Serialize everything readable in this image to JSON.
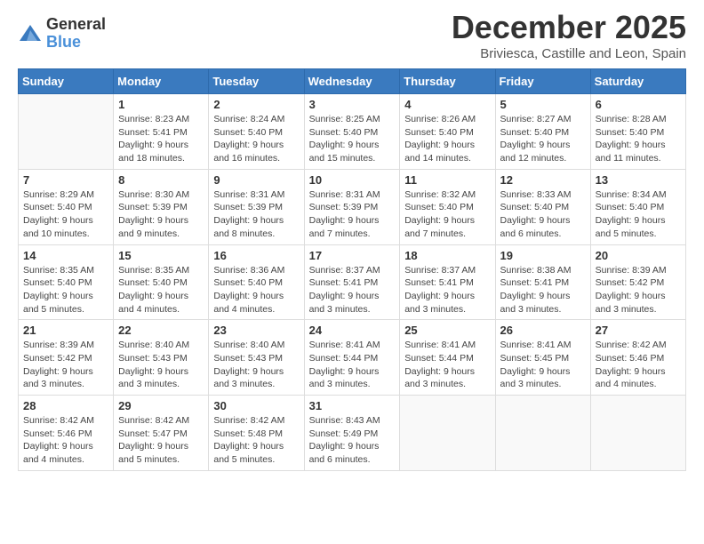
{
  "logo": {
    "general": "General",
    "blue": "Blue"
  },
  "title": "December 2025",
  "subtitle": "Briviesca, Castille and Leon, Spain",
  "days_of_week": [
    "Sunday",
    "Monday",
    "Tuesday",
    "Wednesday",
    "Thursday",
    "Friday",
    "Saturday"
  ],
  "weeks": [
    [
      {
        "day": "",
        "info": ""
      },
      {
        "day": "1",
        "info": "Sunrise: 8:23 AM\nSunset: 5:41 PM\nDaylight: 9 hours\nand 18 minutes."
      },
      {
        "day": "2",
        "info": "Sunrise: 8:24 AM\nSunset: 5:40 PM\nDaylight: 9 hours\nand 16 minutes."
      },
      {
        "day": "3",
        "info": "Sunrise: 8:25 AM\nSunset: 5:40 PM\nDaylight: 9 hours\nand 15 minutes."
      },
      {
        "day": "4",
        "info": "Sunrise: 8:26 AM\nSunset: 5:40 PM\nDaylight: 9 hours\nand 14 minutes."
      },
      {
        "day": "5",
        "info": "Sunrise: 8:27 AM\nSunset: 5:40 PM\nDaylight: 9 hours\nand 12 minutes."
      },
      {
        "day": "6",
        "info": "Sunrise: 8:28 AM\nSunset: 5:40 PM\nDaylight: 9 hours\nand 11 minutes."
      }
    ],
    [
      {
        "day": "7",
        "info": "Sunrise: 8:29 AM\nSunset: 5:40 PM\nDaylight: 9 hours\nand 10 minutes."
      },
      {
        "day": "8",
        "info": "Sunrise: 8:30 AM\nSunset: 5:39 PM\nDaylight: 9 hours\nand 9 minutes."
      },
      {
        "day": "9",
        "info": "Sunrise: 8:31 AM\nSunset: 5:39 PM\nDaylight: 9 hours\nand 8 minutes."
      },
      {
        "day": "10",
        "info": "Sunrise: 8:31 AM\nSunset: 5:39 PM\nDaylight: 9 hours\nand 7 minutes."
      },
      {
        "day": "11",
        "info": "Sunrise: 8:32 AM\nSunset: 5:40 PM\nDaylight: 9 hours\nand 7 minutes."
      },
      {
        "day": "12",
        "info": "Sunrise: 8:33 AM\nSunset: 5:40 PM\nDaylight: 9 hours\nand 6 minutes."
      },
      {
        "day": "13",
        "info": "Sunrise: 8:34 AM\nSunset: 5:40 PM\nDaylight: 9 hours\nand 5 minutes."
      }
    ],
    [
      {
        "day": "14",
        "info": "Sunrise: 8:35 AM\nSunset: 5:40 PM\nDaylight: 9 hours\nand 5 minutes."
      },
      {
        "day": "15",
        "info": "Sunrise: 8:35 AM\nSunset: 5:40 PM\nDaylight: 9 hours\nand 4 minutes."
      },
      {
        "day": "16",
        "info": "Sunrise: 8:36 AM\nSunset: 5:40 PM\nDaylight: 9 hours\nand 4 minutes."
      },
      {
        "day": "17",
        "info": "Sunrise: 8:37 AM\nSunset: 5:41 PM\nDaylight: 9 hours\nand 3 minutes."
      },
      {
        "day": "18",
        "info": "Sunrise: 8:37 AM\nSunset: 5:41 PM\nDaylight: 9 hours\nand 3 minutes."
      },
      {
        "day": "19",
        "info": "Sunrise: 8:38 AM\nSunset: 5:41 PM\nDaylight: 9 hours\nand 3 minutes."
      },
      {
        "day": "20",
        "info": "Sunrise: 8:39 AM\nSunset: 5:42 PM\nDaylight: 9 hours\nand 3 minutes."
      }
    ],
    [
      {
        "day": "21",
        "info": "Sunrise: 8:39 AM\nSunset: 5:42 PM\nDaylight: 9 hours\nand 3 minutes."
      },
      {
        "day": "22",
        "info": "Sunrise: 8:40 AM\nSunset: 5:43 PM\nDaylight: 9 hours\nand 3 minutes."
      },
      {
        "day": "23",
        "info": "Sunrise: 8:40 AM\nSunset: 5:43 PM\nDaylight: 9 hours\nand 3 minutes."
      },
      {
        "day": "24",
        "info": "Sunrise: 8:41 AM\nSunset: 5:44 PM\nDaylight: 9 hours\nand 3 minutes."
      },
      {
        "day": "25",
        "info": "Sunrise: 8:41 AM\nSunset: 5:44 PM\nDaylight: 9 hours\nand 3 minutes."
      },
      {
        "day": "26",
        "info": "Sunrise: 8:41 AM\nSunset: 5:45 PM\nDaylight: 9 hours\nand 3 minutes."
      },
      {
        "day": "27",
        "info": "Sunrise: 8:42 AM\nSunset: 5:46 PM\nDaylight: 9 hours\nand 4 minutes."
      }
    ],
    [
      {
        "day": "28",
        "info": "Sunrise: 8:42 AM\nSunset: 5:46 PM\nDaylight: 9 hours\nand 4 minutes."
      },
      {
        "day": "29",
        "info": "Sunrise: 8:42 AM\nSunset: 5:47 PM\nDaylight: 9 hours\nand 5 minutes."
      },
      {
        "day": "30",
        "info": "Sunrise: 8:42 AM\nSunset: 5:48 PM\nDaylight: 9 hours\nand 5 minutes."
      },
      {
        "day": "31",
        "info": "Sunrise: 8:43 AM\nSunset: 5:49 PM\nDaylight: 9 hours\nand 6 minutes."
      },
      {
        "day": "",
        "info": ""
      },
      {
        "day": "",
        "info": ""
      },
      {
        "day": "",
        "info": ""
      }
    ]
  ]
}
